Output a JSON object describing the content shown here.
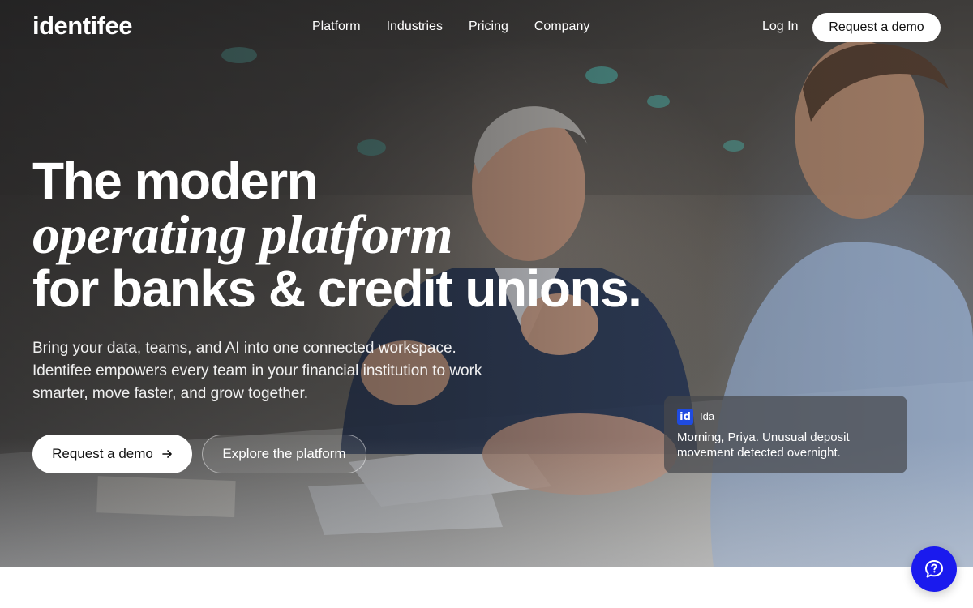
{
  "brand": {
    "logo_text": "identifee"
  },
  "nav": {
    "links": [
      "Platform",
      "Industries",
      "Pricing",
      "Company"
    ],
    "login_label": "Log In",
    "demo_label": "Request a demo"
  },
  "hero": {
    "headline_line1": "The modern",
    "headline_line2": "operating platform",
    "headline_line3": "for banks & credit unions.",
    "subtext": "Bring your data, teams, and AI into one connected workspace. Identifee empowers every team in your financial institution to work smarter, move faster, and grow together.",
    "cta_primary": "Request a demo",
    "cta_secondary": "Explore the platform"
  },
  "ida_card": {
    "badge": "id",
    "name": "Ida",
    "message": "Morning, Priya. Unusual deposit movement detected overnight."
  },
  "colors": {
    "accent_blue": "#1a1aee",
    "ida_badge_blue": "#1f4be0"
  },
  "icons": {
    "cta_arrow": "arrow-right-icon",
    "help": "chat-help-icon"
  }
}
